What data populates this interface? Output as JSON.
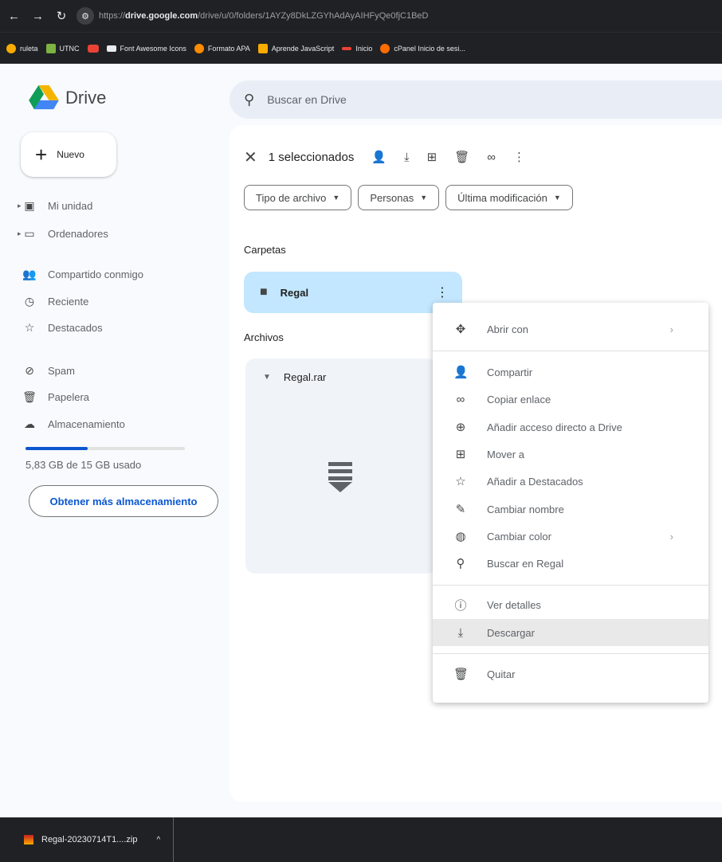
{
  "browser": {
    "url_prefix": "https://",
    "url_domain": "drive.google.com",
    "url_path": "/drive/u/0/folders/1AYZy8DkLZGYhAdAyAIHFyQe0fjC1BeD",
    "bookmarks": [
      {
        "label": "ruleta",
        "color": "#f9ab00"
      },
      {
        "label": "UTNC",
        "color": "#7cb342"
      },
      {
        "label": "",
        "color": "#ea4335"
      },
      {
        "label": "Font Awesome Icons",
        "color": "#e8eaed"
      },
      {
        "label": "Formato APA",
        "color": "#fb8c00"
      },
      {
        "label": "Aprende JavaScript",
        "color": "#f9ab00"
      },
      {
        "label": "Inicio",
        "color": "#ea4335"
      },
      {
        "label": "cPanel Inicio de sesi...",
        "color": "#ff6d00"
      }
    ]
  },
  "app": {
    "name": "Drive"
  },
  "search": {
    "placeholder": "Buscar en Drive"
  },
  "sidebar": {
    "new_label": "Nuevo",
    "items": [
      {
        "label": "Mi unidad",
        "icon": "my-drive-icon"
      },
      {
        "label": "Ordenadores",
        "icon": "computers-icon"
      },
      {
        "label": "Compartido conmigo",
        "icon": "shared-icon"
      },
      {
        "label": "Reciente",
        "icon": "clock-icon"
      },
      {
        "label": "Destacados",
        "icon": "star-icon"
      },
      {
        "label": "Spam",
        "icon": "spam-icon"
      },
      {
        "label": "Papelera",
        "icon": "trash-icon"
      },
      {
        "label": "Almacenamiento",
        "icon": "cloud-icon"
      }
    ],
    "storage_text": "5,83 GB de 15 GB usado",
    "storage_fraction": 0.39,
    "more_storage_label": "Obtener más almacenamiento"
  },
  "toolbar": {
    "selection_text": "1 seleccionados"
  },
  "filters": [
    "Tipo de archivo",
    "Personas",
    "Última modificación"
  ],
  "sections": {
    "folders": "Carpetas",
    "files": "Archivos"
  },
  "folder": {
    "name": "Regal"
  },
  "file": {
    "name": "Regal.rar"
  },
  "context_menu": {
    "items": [
      {
        "label": "Abrir con",
        "icon": "open-with-icon",
        "submenu": true
      },
      {
        "label": "Compartir",
        "icon": "share-icon"
      },
      {
        "label": "Copiar enlace",
        "icon": "link-icon"
      },
      {
        "label": "Añadir acceso directo a Drive",
        "icon": "shortcut-icon"
      },
      {
        "label": "Mover a",
        "icon": "move-icon"
      },
      {
        "label": "Añadir a Destacados",
        "icon": "star-icon"
      },
      {
        "label": "Cambiar nombre",
        "icon": "rename-icon"
      },
      {
        "label": "Cambiar color",
        "icon": "palette-icon",
        "submenu": true
      },
      {
        "label": "Buscar en Regal",
        "icon": "search-icon"
      },
      {
        "label": "Ver detalles",
        "icon": "info-icon"
      },
      {
        "label": "Descargar",
        "icon": "download-icon",
        "highlighted": true
      },
      {
        "label": "Quitar",
        "icon": "trash-icon"
      }
    ]
  },
  "download_shelf": {
    "file": "Regal-20230714T1....zip"
  }
}
